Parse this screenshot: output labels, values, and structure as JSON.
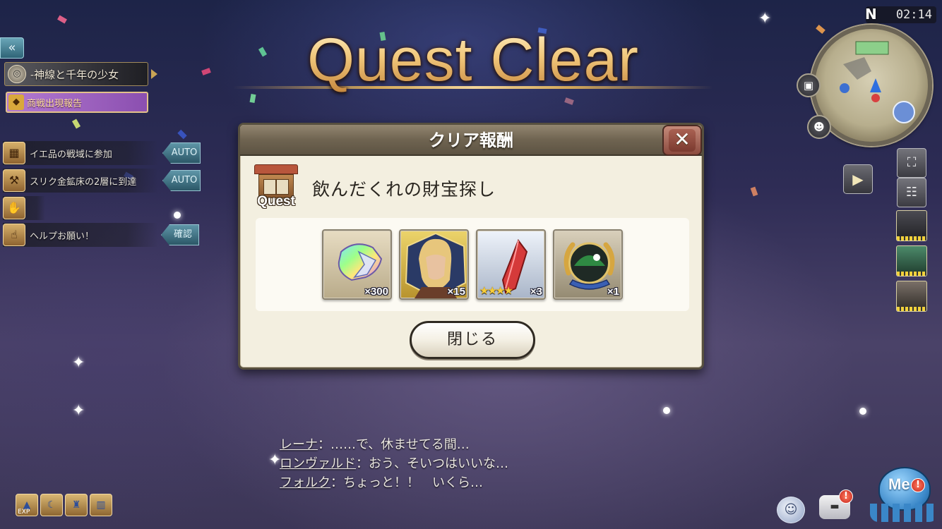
{
  "screen": {
    "title": "Quest Clear"
  },
  "left_panel": {
    "story_title": "-神線と千年の少女",
    "report_label": "商戦出現報告",
    "tasks": [
      {
        "label": "イエ品の戦域に参加",
        "tag": "AUTO"
      },
      {
        "label": "スリク金鉱床の2層に到達",
        "tag": "AUTO"
      },
      {
        "label": "",
        "tag": ""
      },
      {
        "label": "ヘルプお願い！",
        "tag": "確認"
      }
    ],
    "bottom_icons": [
      {
        "name": "exp-boost-icon",
        "caption": "EXP"
      },
      {
        "name": "moon-boost-icon",
        "caption": ""
      },
      {
        "name": "drop-boost-icon",
        "caption": ""
      },
      {
        "name": "stat-boost-icon",
        "caption": ""
      }
    ]
  },
  "dialog": {
    "title": "クリア報酬",
    "quest_badge": "Quest",
    "quest_name": "飲んだくれの財宝探し",
    "rewards": [
      {
        "item": "rainbow-crystal",
        "count": "×300"
      },
      {
        "item": "character-portrait",
        "count": "×15"
      },
      {
        "item": "red-crystal",
        "count": "×3",
        "stars": "★★★★"
      },
      {
        "item": "green-hat-emblem",
        "count": "×1"
      }
    ],
    "close_label": "閉じる"
  },
  "hud": {
    "compass_letter": "N",
    "clock": "02:14"
  },
  "dialogue": [
    {
      "speaker": "レーナ",
      "text": "：……で、休ませてる間…"
    },
    {
      "speaker": "ロンヴァルド",
      "text": "：おう、そいつはいいな…"
    },
    {
      "speaker": "フォルク",
      "text": "：ちょっと！！　いくら…"
    }
  ],
  "bottom_right": {
    "mascot_label": "Me",
    "badge": "!"
  },
  "colors": {
    "title_gold": "#e9b968",
    "dialog_bg": "#f3efe0",
    "dialog_header": "#6f6451",
    "close_red": "#8b4a3e",
    "auto_tag": "#2b5767"
  }
}
